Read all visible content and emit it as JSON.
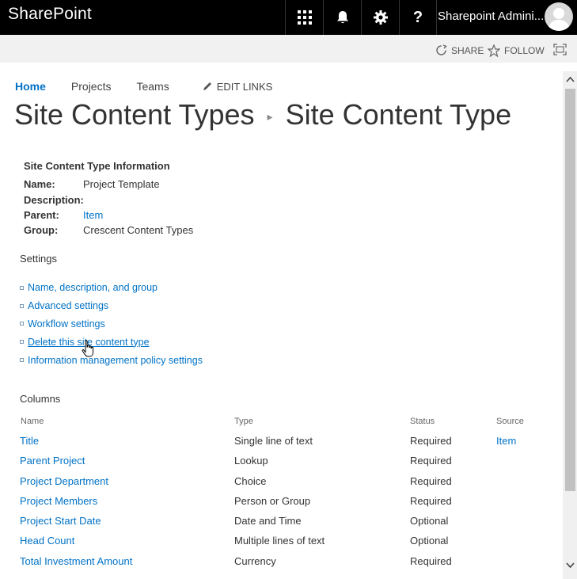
{
  "suitebar": {
    "brand": "SharePoint",
    "help_label": "?",
    "user_name": "Sharepoint Admini..."
  },
  "actionbar": {
    "share_label": "SHARE",
    "follow_label": "FOLLOW"
  },
  "topnav": {
    "items": [
      {
        "label": "Home"
      },
      {
        "label": "Projects"
      },
      {
        "label": "Teams"
      }
    ],
    "edit_links_label": "EDIT LINKS"
  },
  "page_title": {
    "parent": "Site Content Types",
    "current": "Site Content Type"
  },
  "info": {
    "heading": "Site Content Type Information",
    "rows": [
      {
        "key": "Name:",
        "value": "Project Template"
      },
      {
        "key": "Description:",
        "value": ""
      },
      {
        "key": "Parent:",
        "value": "Item"
      },
      {
        "key": "Group:",
        "value": "Crescent Content Types"
      }
    ]
  },
  "settings": {
    "heading": "Settings",
    "items": [
      {
        "label": "Name, description, and group"
      },
      {
        "label": "Advanced settings"
      },
      {
        "label": "Workflow settings"
      },
      {
        "label": "Delete this site content type"
      },
      {
        "label": "Information management policy settings"
      }
    ]
  },
  "columns": {
    "heading": "Columns",
    "headers": {
      "name": "Name",
      "type": "Type",
      "status": "Status",
      "source": "Source"
    },
    "rows": [
      {
        "name": "Title",
        "type": "Single line of text",
        "status": "Required",
        "source": "Item"
      },
      {
        "name": "Parent Project",
        "type": "Lookup",
        "status": "Required",
        "source": ""
      },
      {
        "name": "Project Department",
        "type": "Choice",
        "status": "Required",
        "source": ""
      },
      {
        "name": "Project Members",
        "type": "Person or Group",
        "status": "Required",
        "source": ""
      },
      {
        "name": "Project Start Date",
        "type": "Date and Time",
        "status": "Optional",
        "source": ""
      },
      {
        "name": "Head Count",
        "type": "Multiple lines of text",
        "status": "Optional",
        "source": ""
      },
      {
        "name": "Total Investment Amount",
        "type": "Currency",
        "status": "Required",
        "source": ""
      }
    ]
  },
  "icons": {
    "apps": "app-launcher-icon",
    "bell": "bell-icon",
    "gear": "gear-icon",
    "help": "help-icon",
    "share": "share-icon",
    "follow": "star-icon",
    "focus": "focus-mode-icon",
    "edit": "pencil-icon"
  },
  "colors": {
    "suitebar_bg": "#000000",
    "link": "#0072c6",
    "actionbar_bg": "#f1f1f1"
  }
}
